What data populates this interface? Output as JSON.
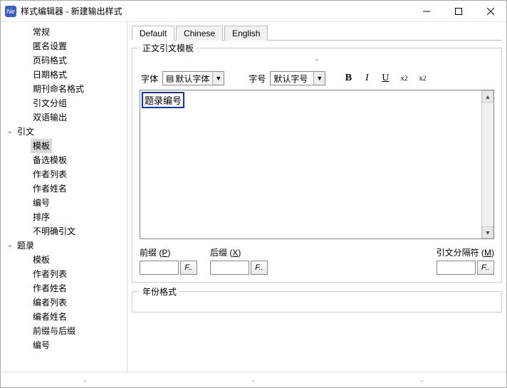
{
  "window": {
    "title": "样式编辑器 - 新建输出样式",
    "icon_label": "Ne"
  },
  "sidebar": {
    "items": [
      {
        "label": "常规",
        "depth": 1
      },
      {
        "label": "匿名设置",
        "depth": 1
      },
      {
        "label": "页码格式",
        "depth": 1
      },
      {
        "label": "日期格式",
        "depth": 1
      },
      {
        "label": "期刊命名格式",
        "depth": 1
      },
      {
        "label": "引文分组",
        "depth": 1
      },
      {
        "label": "双语输出",
        "depth": 1
      },
      {
        "label": "引文",
        "depth": 0,
        "expanded": true
      },
      {
        "label": "模板",
        "depth": 1,
        "selected": true
      },
      {
        "label": "备选模板",
        "depth": 1
      },
      {
        "label": "作者列表",
        "depth": 1
      },
      {
        "label": "作者姓名",
        "depth": 1
      },
      {
        "label": "编号",
        "depth": 1
      },
      {
        "label": "排序",
        "depth": 1
      },
      {
        "label": "不明确引文",
        "depth": 1
      },
      {
        "label": "题录",
        "depth": 0,
        "expanded": true
      },
      {
        "label": "模板",
        "depth": 1
      },
      {
        "label": "作者列表",
        "depth": 1
      },
      {
        "label": "作者姓名",
        "depth": 1
      },
      {
        "label": "编者列表",
        "depth": 1
      },
      {
        "label": "编者姓名",
        "depth": 1
      },
      {
        "label": "前缀与后缀",
        "depth": 1
      },
      {
        "label": "编号",
        "depth": 1
      }
    ]
  },
  "tabs": [
    {
      "label": "Default",
      "active": true
    },
    {
      "label": "Chinese"
    },
    {
      "label": "English"
    }
  ],
  "group": {
    "legend": "正文引文模板",
    "dash": "-",
    "font_label": "字体",
    "font_value": "默认字体",
    "size_label": "字号",
    "size_value": "默认字号",
    "editor_field": "题录编号",
    "prefix_label_pre": "前缀 (",
    "prefix_key": "P",
    "suffix_label_pre": "后缀 (",
    "suffix_key": "X",
    "sep_label_pre": "引文分隔符 (",
    "sep_key": "M",
    "paren_close": ")",
    "fbtn": "F.."
  },
  "year_legend": "年份格式",
  "status": {
    "a": "-",
    "b": "-",
    "c": "-"
  }
}
